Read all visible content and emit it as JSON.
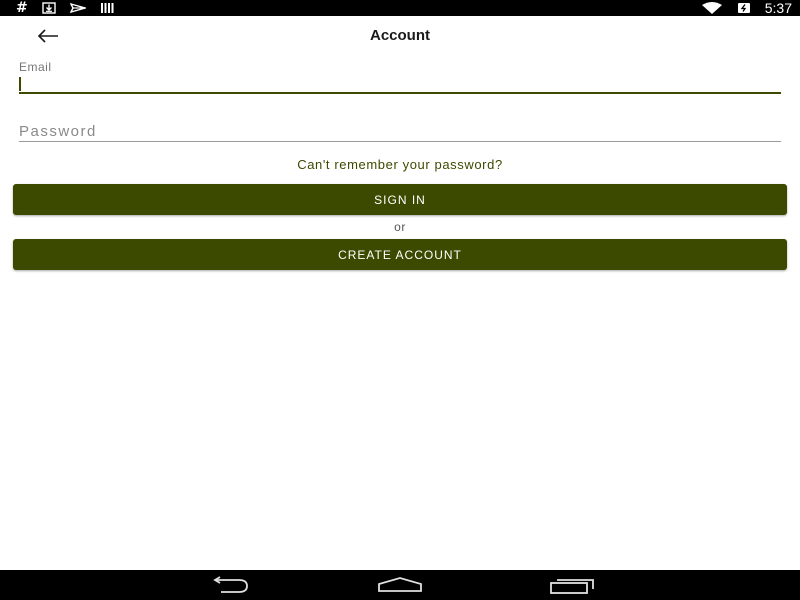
{
  "status_bar": {
    "left_icons": [
      "hash-icon",
      "download-icon",
      "send-icon",
      "barcode-icon"
    ],
    "right_icons": [
      "wifi-icon",
      "battery-icon"
    ],
    "time": "5:37"
  },
  "app_bar": {
    "back_icon": "arrow-left-icon",
    "title": "Account"
  },
  "form": {
    "email": {
      "label": "Email",
      "value": ""
    },
    "password": {
      "placeholder": "Password",
      "value": ""
    },
    "forgot_link": "Can't remember your password?",
    "sign_in_label": "SIGN IN",
    "or_label": "or",
    "create_account_label": "CREATE ACCOUNT"
  },
  "nav_bar": {
    "icons": [
      "nav-back-icon",
      "nav-home-icon",
      "nav-recents-icon"
    ]
  },
  "colors": {
    "accent": "#3c4a00",
    "status_bar_bg": "#000000",
    "background": "#ffffff"
  }
}
